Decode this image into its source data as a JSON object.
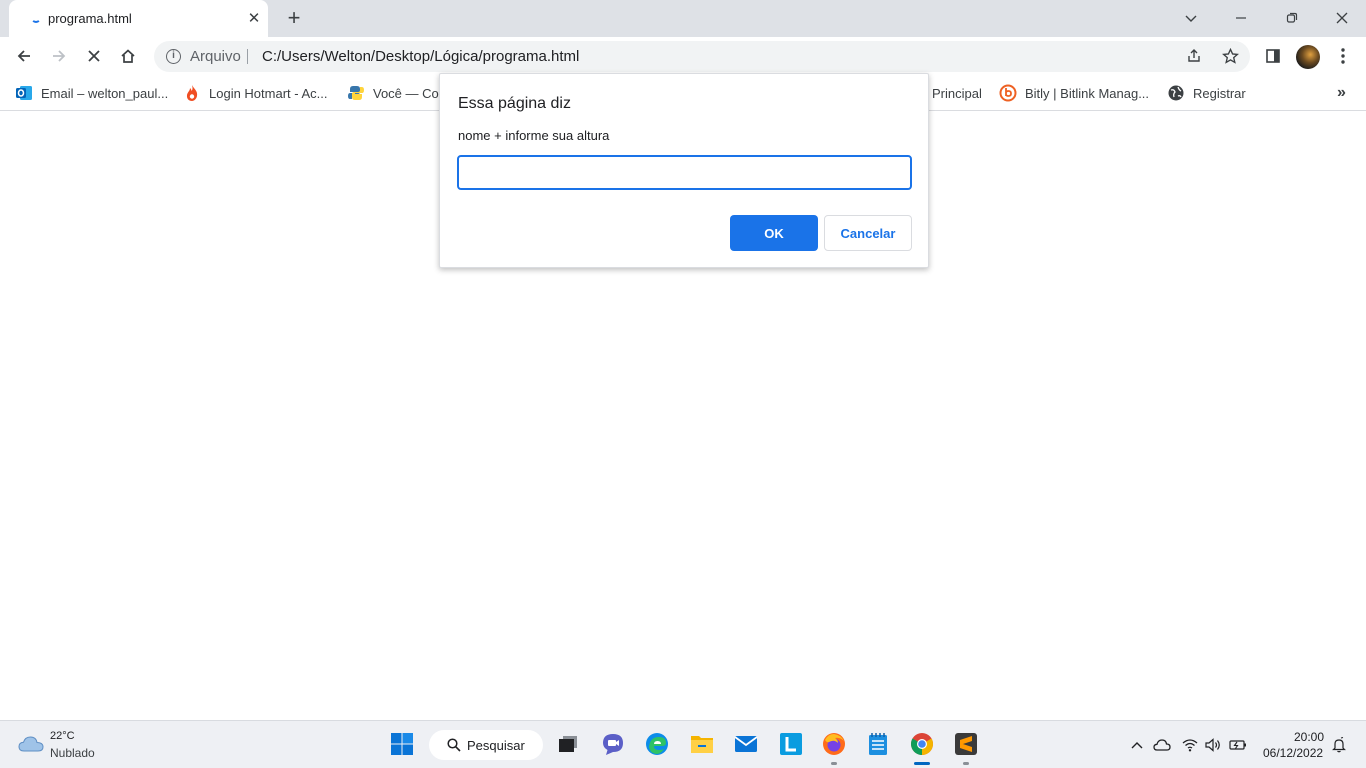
{
  "tab": {
    "title": "programa.html",
    "close_glyph": "✕",
    "new_glyph": "+"
  },
  "omnibox": {
    "scheme_label": "Arquivo",
    "url": "C:/Users/Welton/Desktop/Lógica/programa.html"
  },
  "bookmarks": [
    {
      "label": "Email – welton_paul...",
      "icon": "outlook-icon"
    },
    {
      "label": "Login Hotmart - Ac...",
      "icon": "hotmart-icon"
    },
    {
      "label": "Você — Co",
      "icon": "python-icon"
    },
    {
      "label": "Principal",
      "icon": "bookmark-icon"
    },
    {
      "label": "Bitly | Bitlink Manag...",
      "icon": "bitly-icon"
    },
    {
      "label": "Registrar",
      "icon": "globe-icon"
    }
  ],
  "bookmarks_more": "»",
  "dialog": {
    "title": "Essa página diz",
    "message": "nome + informe sua altura",
    "input_value": "",
    "ok_label": "OK",
    "cancel_label": "Cancelar"
  },
  "taskbar": {
    "weather": {
      "temp": "22°C",
      "desc": "Nublado"
    },
    "search_label": "Pesquisar",
    "clock": {
      "time": "20:00",
      "date": "06/12/2022"
    }
  },
  "colors": {
    "accent": "#1a73e8",
    "tabstrip": "#dee1e6",
    "taskbar": "#eef0f4"
  }
}
